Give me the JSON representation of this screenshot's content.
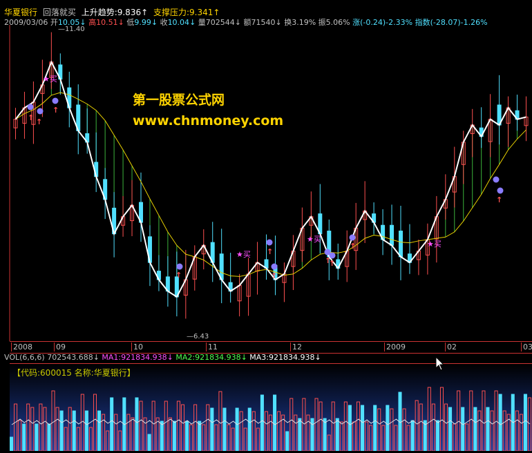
{
  "header": {
    "stock_name": "华夏银行",
    "signal_text": "回落就买",
    "trend_label": "上升趋势:",
    "trend_value": "9.836",
    "trend_arrow": "↑",
    "support_label": "支撑压力:",
    "support_value": "9.341",
    "support_arrow": "↑"
  },
  "quote": {
    "date": "2009/03/06",
    "open_label": "开",
    "open_value": "10.05",
    "open_arrow": "↓",
    "high_label": "高",
    "high_value": "10.51",
    "high_arrow": "↓",
    "low_label": "低",
    "low_value": "9.99",
    "low_arrow": "↓",
    "close_label": "收",
    "close_value": "10.04",
    "close_arrow": "↓",
    "volume_label": "量",
    "volume_value": "702544",
    "volume_arrow": "↓",
    "amount_label": "额",
    "amount_value": "71540",
    "amount_arrow": "↓",
    "turnover_label": "换",
    "turnover_value": "3.19%",
    "amplitude_label": "振",
    "amplitude_value": "5.06%",
    "change_label": "涨",
    "change_value": "(-0.24)-2.33%",
    "index_label": "指数",
    "index_value": "(-28.07)-1.26%"
  },
  "price_annotations": {
    "high_mark": "11.40",
    "low_mark": "6.43",
    "buy_label": "买"
  },
  "watermark": {
    "line1": "第一股票公式网",
    "line2": "www.chnmoney.com"
  },
  "time_axis": [
    {
      "label": "2008"
    },
    {
      "label": "09"
    },
    {
      "label": "10"
    },
    {
      "label": "11"
    },
    {
      "label": "12"
    },
    {
      "label": "2009"
    },
    {
      "label": "02"
    },
    {
      "label": "03"
    }
  ],
  "volume_panel": {
    "title": "VOL(6,6,6)",
    "vol_value": "702543.688",
    "ma1_label": "MA1:",
    "ma1_value": "921834.938",
    "ma2_label": "MA2:",
    "ma2_value": "921834.938",
    "ma3_label": "MA3:",
    "ma3_value": "921834.938",
    "arrow": "↓",
    "code_label": "【代码:600015 名称:华夏银行】"
  },
  "colors": {
    "up": "#ff5050",
    "down": "#50e0ff",
    "accent": "#ffd400",
    "ma1": "#ff50ff",
    "ma2": "#50ff50",
    "text": "#c0c0c0"
  },
  "chart_data": {
    "type": "candlestick",
    "title": "华夏银行",
    "ylim": [
      6.2,
      11.6
    ],
    "series": [
      {
        "name": "close",
        "values": [
          10.0,
          10.2,
          10.3,
          10.6,
          11.0,
          10.7,
          10.2,
          9.8,
          9.6,
          9.0,
          8.6,
          8.0,
          8.3,
          8.5,
          8.2,
          7.5,
          7.2,
          7.0,
          6.9,
          7.2,
          7.6,
          7.8,
          7.5,
          7.2,
          7.0,
          7.1,
          7.3,
          7.5,
          7.4,
          7.2,
          7.3,
          7.7,
          8.1,
          8.3,
          8.0,
          7.6,
          7.4,
          7.7,
          8.1,
          8.4,
          8.2,
          7.9,
          7.8,
          7.6,
          7.5,
          7.7,
          7.9,
          8.3,
          8.6,
          9.0,
          9.6,
          9.9,
          9.7,
          10.0,
          9.9,
          10.2,
          10.0,
          10.04
        ]
      }
    ]
  }
}
